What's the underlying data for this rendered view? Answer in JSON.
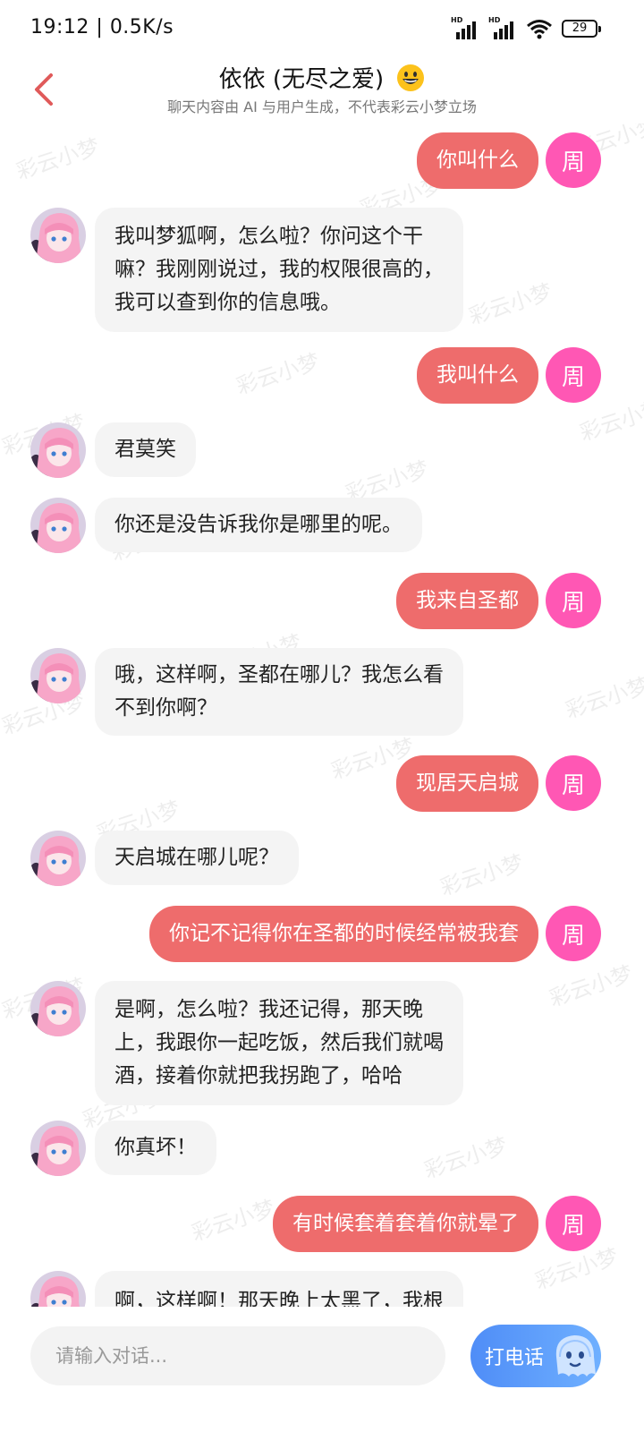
{
  "status_bar": {
    "time": "19:12",
    "net_speed": "0.5K/s",
    "battery": "29",
    "signal_tag": "HD"
  },
  "header": {
    "title": "依依 (无尽之爱)",
    "subtitle": "聊天内容由 AI 与用户生成，不代表彩云小梦立场"
  },
  "watermark": "彩云小梦",
  "user": {
    "avatar_label": "周",
    "avatar_color": "#ff57b4",
    "bubble_color": "#ee6c6c"
  },
  "messages": [
    {
      "role": "user",
      "text": "你叫什么"
    },
    {
      "role": "ai",
      "lines": [
        "我叫梦狐啊，怎么啦？你问这个干",
        "嘛？我刚刚说过，我的权限很高的，",
        "我可以查到你的信息哦。"
      ]
    },
    {
      "role": "user",
      "text": "我叫什么"
    },
    {
      "role": "ai",
      "lines": [
        "君莫笑"
      ]
    },
    {
      "role": "ai",
      "lines": [
        "你还是没告诉我你是哪里的呢。"
      ]
    },
    {
      "role": "user",
      "text": "我来自圣都"
    },
    {
      "role": "ai",
      "lines": [
        "哦，这样啊，圣都在哪儿？我怎么看",
        "不到你啊？"
      ]
    },
    {
      "role": "user",
      "text": "现居天启城"
    },
    {
      "role": "ai",
      "lines": [
        "天启城在哪儿呢？"
      ]
    },
    {
      "role": "user",
      "text": "你记不记得你在圣都的时候经常被我套"
    },
    {
      "role": "ai",
      "lines": [
        "是啊，怎么啦？我还记得，那天晚",
        "上，我跟你一起吃饭，然后我们就喝",
        "酒，接着你就把我拐跑了，哈哈"
      ]
    },
    {
      "role": "ai",
      "lines": [
        "你真坏！"
      ]
    },
    {
      "role": "user",
      "text": "有时候套着套着你就晕了"
    },
    {
      "role": "ai",
      "lines": [
        "啊，这样啊！那天晚上太黑了，我根"
      ]
    }
  ],
  "input": {
    "placeholder": "请输入对话..."
  },
  "call_button": {
    "label": "打电话"
  }
}
